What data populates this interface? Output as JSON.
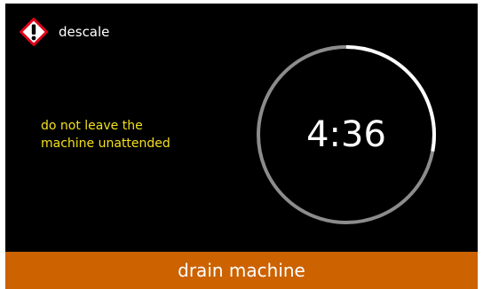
{
  "header": {
    "icon": "warning-diamond-icon",
    "title": "descale"
  },
  "warning": {
    "lines": [
      "do not leave the",
      "machine unattended"
    ],
    "color": "#f2e01c"
  },
  "timer": {
    "remaining": "4:36",
    "progress_fraction": 0.28,
    "track_color": "#8c8c8c",
    "progress_color": "#ffffff"
  },
  "action": {
    "label": "drain machine",
    "color": "#cc6200"
  }
}
